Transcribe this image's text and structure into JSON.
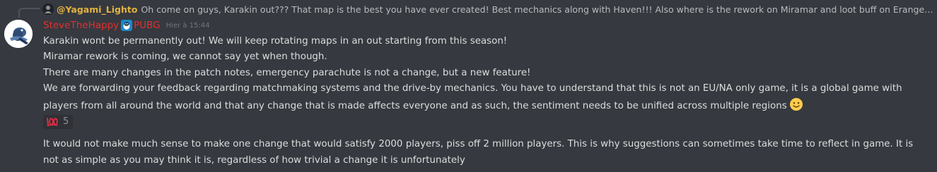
{
  "reply": {
    "author": "@Yagami_Lighto",
    "text": "Oh come on guys, Karakin out??? That map is the best you have ever created! Best mechanics along with Haven!!! Also where is the rework on Miramar and loot buff on Erangel and Miramar..."
  },
  "message": {
    "author": "SteveTheHappy",
    "role_tag": "PUBG",
    "timestamp": "Hier à 15:44",
    "author_color": "#e03030",
    "lines": [
      "Karakin wont be permanently out! We will keep rotating maps in an out starting from this season!",
      "Miramar rework is coming, we cannot say yet when though.",
      "There are many changes in the patch notes, emergency parachute is not a change, but a new feature!",
      "We are forwarding your feedback regarding matchmaking systems and the drive-by mechanics. You have to understand that this is not an EU/NA only game, it is a global game with players from all around the world and that any change that is made affects everyone and as such, the sentiment needs to be unified across multiple regions"
    ],
    "followup": "It would not make much sense to make one change that would satisfy 2000 players, piss off 2 million players. This is why suggestions can sometimes take time to reflect in game. It is not as simple as you may think it is, regardless of how trivial a change it is unfortunately"
  },
  "reaction": {
    "emoji": "hundred-points-icon",
    "count": "5"
  },
  "icons": {
    "reply_avatar": "reply-avatar-icon",
    "bot_badge": "penguin-badge-icon",
    "inline_emoji": "slightly-smiling-face-icon"
  }
}
